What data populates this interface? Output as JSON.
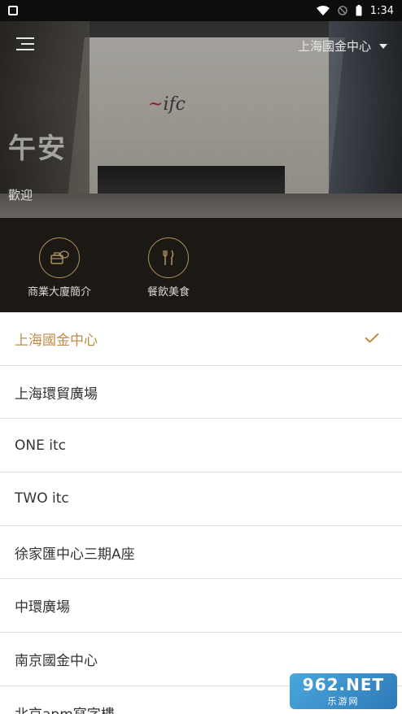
{
  "status_bar": {
    "time": "1:34"
  },
  "header": {
    "location_label": "上海國金中心",
    "greeting": "午安",
    "welcome": "歡迎"
  },
  "hero": {
    "logo_text": "ifc"
  },
  "quick_actions": [
    {
      "label": "商業大廈簡介",
      "icon": "briefcase-chat-icon"
    },
    {
      "label": "餐飲美食",
      "icon": "fork-knife-icon"
    }
  ],
  "locations": [
    {
      "label": "上海國金中心",
      "selected": true
    },
    {
      "label": "上海環貿廣場",
      "selected": false
    },
    {
      "label": "ONE itc",
      "selected": false
    },
    {
      "label": "TWO itc",
      "selected": false
    },
    {
      "label": "徐家匯中心三期A座",
      "selected": false
    },
    {
      "label": "中環廣場",
      "selected": false
    },
    {
      "label": "南京國金中心",
      "selected": false
    },
    {
      "label": "北京apm寫字樓",
      "selected": false
    }
  ],
  "watermark": {
    "main": "962.NET",
    "sub": "乐游网"
  },
  "colors": {
    "accent": "#c08a4a",
    "dark_band": "#1c1915",
    "divider": "#e2e2e2"
  }
}
